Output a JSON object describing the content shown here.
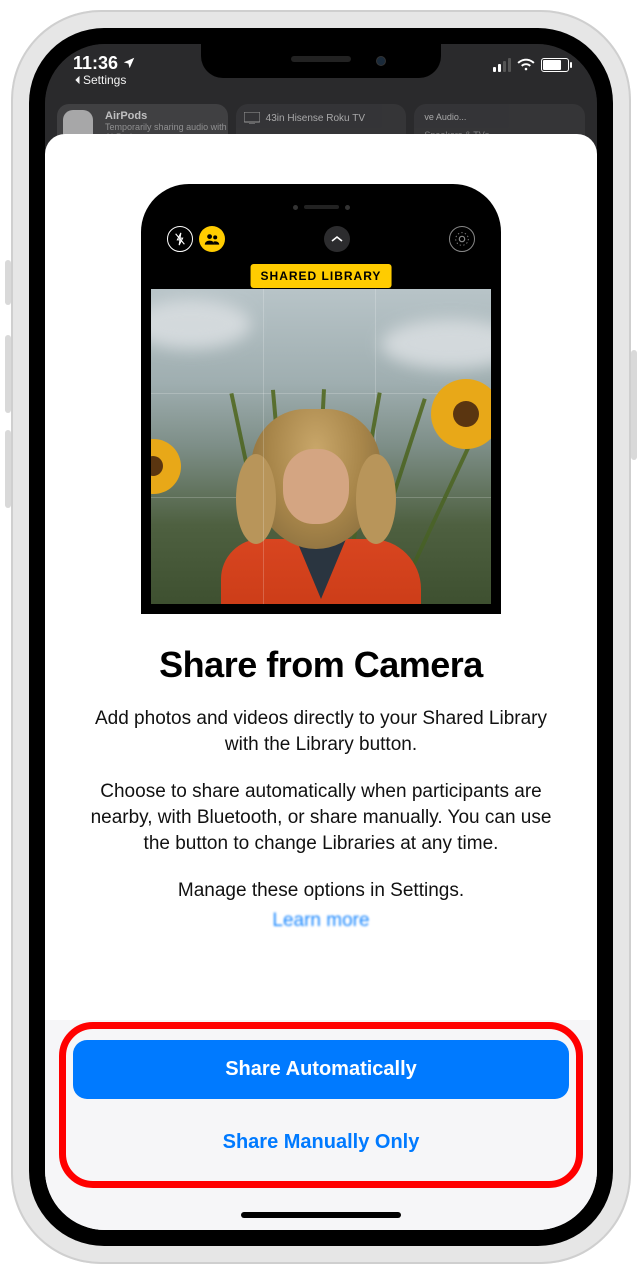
{
  "status": {
    "time": "11:36",
    "location_icon": "location-arrow",
    "back_label": "Settings"
  },
  "background": {
    "card1_title": "AirPods",
    "card1_sub": "Temporarily sharing audio with AirPods",
    "card2_label": "43in Hisense Roku TV",
    "card3_label1": "ve Audio...",
    "card3_label2": "Speakers & TVs"
  },
  "hero": {
    "badge": "SHARED LIBRARY"
  },
  "content": {
    "title": "Share from Camera",
    "p1": "Add photos and videos directly to your Shared Library with the Library button.",
    "p2": "Choose to share automatically when participants are nearby, with Bluetooth, or share manually. You can use the button to change Libraries at any time.",
    "p3": "Manage these options in Settings.",
    "learn_more": "Learn more"
  },
  "buttons": {
    "primary": "Share Automatically",
    "secondary": "Share Manually Only"
  }
}
